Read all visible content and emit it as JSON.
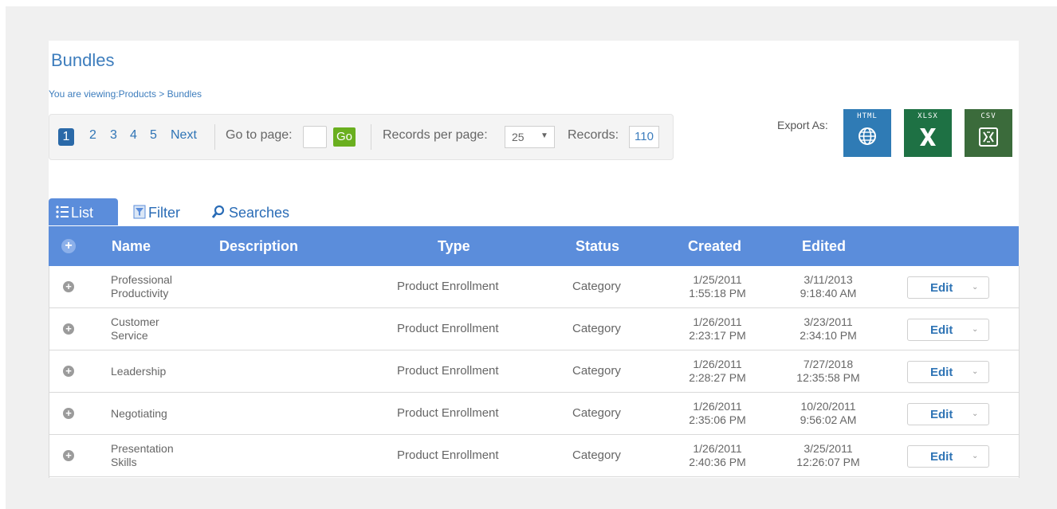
{
  "page": {
    "title": "Bundles",
    "breadcrumb": "You are viewing:Products > Bundles"
  },
  "pager": {
    "pages": [
      "1",
      "2",
      "3",
      "4",
      "5"
    ],
    "current_page": "1",
    "next_label": "Next",
    "goto_label": "Go to page:",
    "goto_value": "",
    "go_button": "Go",
    "records_per_page_label": "Records per page:",
    "records_per_page_value": "25",
    "records_label": "Records:",
    "records_value": "110"
  },
  "export": {
    "label": "Export As:",
    "options": [
      {
        "label": "HTML",
        "icon": "globe-icon",
        "color": "#2f7bb5"
      },
      {
        "label": "XLSX",
        "icon": "excel-icon",
        "color": "#1e7144"
      },
      {
        "label": "CSV",
        "icon": "csv-icon",
        "color": "#3b6b3b"
      }
    ]
  },
  "tabs": [
    {
      "label": "List",
      "icon": "list-icon",
      "active": true
    },
    {
      "label": "Filter",
      "icon": "filter-icon",
      "active": false
    },
    {
      "label": "Searches",
      "icon": "search-icon",
      "active": false
    }
  ],
  "table": {
    "columns": [
      "Name",
      "Description",
      "Type",
      "Status",
      "Created",
      "Edited"
    ],
    "edit_label": "Edit",
    "rows": [
      {
        "name_1": "Professional",
        "name_2": "Productivity",
        "description": "",
        "type": "Product Enrollment",
        "status": "Category",
        "created_date": "1/25/2011",
        "created_time": "1:55:18 PM",
        "edited_date": "3/11/2013",
        "edited_time": "9:18:40 AM"
      },
      {
        "name_1": "Customer",
        "name_2": "Service",
        "description": "",
        "type": "Product Enrollment",
        "status": "Category",
        "created_date": "1/26/2011",
        "created_time": "2:23:17 PM",
        "edited_date": "3/23/2011",
        "edited_time": "2:34:10 PM"
      },
      {
        "name_1": "Leadership",
        "name_2": "",
        "description": "",
        "type": "Product Enrollment",
        "status": "Category",
        "created_date": "1/26/2011",
        "created_time": "2:28:27 PM",
        "edited_date": "7/27/2018",
        "edited_time": "12:35:58 PM"
      },
      {
        "name_1": "Negotiating",
        "name_2": "",
        "description": "",
        "type": "Product Enrollment",
        "status": "Category",
        "created_date": "1/26/2011",
        "created_time": "2:35:06 PM",
        "edited_date": "10/20/2011",
        "edited_time": "9:56:02 AM"
      },
      {
        "name_1": "Presentation",
        "name_2": "Skills",
        "description": "",
        "type": "Product Enrollment",
        "status": "Category",
        "created_date": "1/26/2011",
        "created_time": "2:40:36 PM",
        "edited_date": "3/25/2011",
        "edited_time": "12:26:07 PM"
      }
    ]
  }
}
